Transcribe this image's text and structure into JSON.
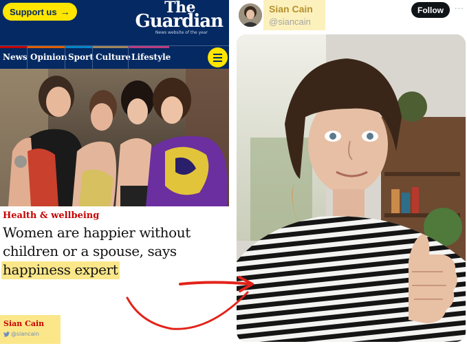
{
  "guardian": {
    "support_label": "Support us",
    "support_arrow": "→",
    "logo_the": "The",
    "logo_main": "Guardian",
    "logo_tagline": "News website of the year",
    "nav": [
      {
        "label": "News",
        "color": "#c70000"
      },
      {
        "label": "Opinion",
        "color": "#e05e00"
      },
      {
        "label": "Sport",
        "color": "#0084c6"
      },
      {
        "label": "Culture",
        "color": "#a1845c"
      },
      {
        "label": "Lifestyle",
        "color": "#bb3b80"
      }
    ],
    "kicker": "Health & wellbeing",
    "headline_lines": [
      "Women are happier without",
      "children or a spouse, says",
      "happiness expert"
    ],
    "byline_name": "Sian Cain",
    "byline_handle": "@siancain"
  },
  "tweet": {
    "name": "Sian Cain",
    "handle": "@siancain",
    "follow_label": "Follow",
    "more_label": "···"
  },
  "colors": {
    "guardian_blue": "#052962",
    "support_yellow": "#ffe500",
    "highlight_yellow": "#fbe78a",
    "kicker_red": "#c70000",
    "arrow_red": "#e2231a"
  }
}
